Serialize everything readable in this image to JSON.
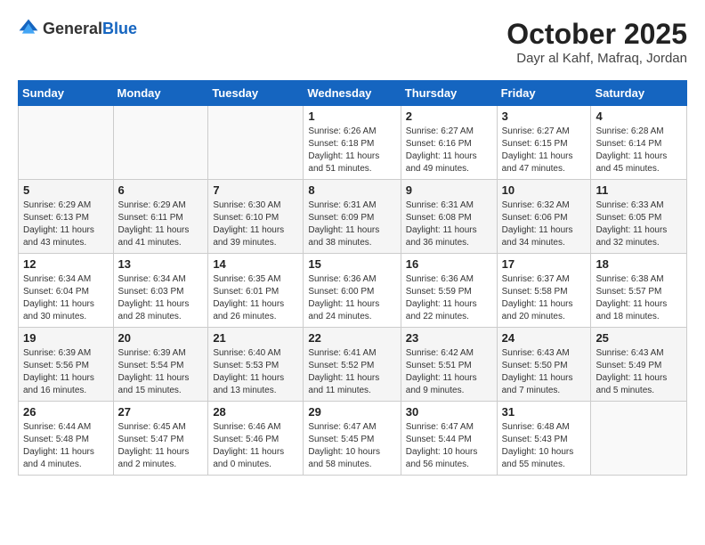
{
  "header": {
    "logo_general": "General",
    "logo_blue": "Blue",
    "month_title": "October 2025",
    "location": "Dayr al Kahf, Mafraq, Jordan"
  },
  "calendar": {
    "days_of_week": [
      "Sunday",
      "Monday",
      "Tuesday",
      "Wednesday",
      "Thursday",
      "Friday",
      "Saturday"
    ],
    "weeks": [
      [
        {
          "day": "",
          "info": ""
        },
        {
          "day": "",
          "info": ""
        },
        {
          "day": "",
          "info": ""
        },
        {
          "day": "1",
          "info": "Sunrise: 6:26 AM\nSunset: 6:18 PM\nDaylight: 11 hours\nand 51 minutes."
        },
        {
          "day": "2",
          "info": "Sunrise: 6:27 AM\nSunset: 6:16 PM\nDaylight: 11 hours\nand 49 minutes."
        },
        {
          "day": "3",
          "info": "Sunrise: 6:27 AM\nSunset: 6:15 PM\nDaylight: 11 hours\nand 47 minutes."
        },
        {
          "day": "4",
          "info": "Sunrise: 6:28 AM\nSunset: 6:14 PM\nDaylight: 11 hours\nand 45 minutes."
        }
      ],
      [
        {
          "day": "5",
          "info": "Sunrise: 6:29 AM\nSunset: 6:13 PM\nDaylight: 11 hours\nand 43 minutes."
        },
        {
          "day": "6",
          "info": "Sunrise: 6:29 AM\nSunset: 6:11 PM\nDaylight: 11 hours\nand 41 minutes."
        },
        {
          "day": "7",
          "info": "Sunrise: 6:30 AM\nSunset: 6:10 PM\nDaylight: 11 hours\nand 39 minutes."
        },
        {
          "day": "8",
          "info": "Sunrise: 6:31 AM\nSunset: 6:09 PM\nDaylight: 11 hours\nand 38 minutes."
        },
        {
          "day": "9",
          "info": "Sunrise: 6:31 AM\nSunset: 6:08 PM\nDaylight: 11 hours\nand 36 minutes."
        },
        {
          "day": "10",
          "info": "Sunrise: 6:32 AM\nSunset: 6:06 PM\nDaylight: 11 hours\nand 34 minutes."
        },
        {
          "day": "11",
          "info": "Sunrise: 6:33 AM\nSunset: 6:05 PM\nDaylight: 11 hours\nand 32 minutes."
        }
      ],
      [
        {
          "day": "12",
          "info": "Sunrise: 6:34 AM\nSunset: 6:04 PM\nDaylight: 11 hours\nand 30 minutes."
        },
        {
          "day": "13",
          "info": "Sunrise: 6:34 AM\nSunset: 6:03 PM\nDaylight: 11 hours\nand 28 minutes."
        },
        {
          "day": "14",
          "info": "Sunrise: 6:35 AM\nSunset: 6:01 PM\nDaylight: 11 hours\nand 26 minutes."
        },
        {
          "day": "15",
          "info": "Sunrise: 6:36 AM\nSunset: 6:00 PM\nDaylight: 11 hours\nand 24 minutes."
        },
        {
          "day": "16",
          "info": "Sunrise: 6:36 AM\nSunset: 5:59 PM\nDaylight: 11 hours\nand 22 minutes."
        },
        {
          "day": "17",
          "info": "Sunrise: 6:37 AM\nSunset: 5:58 PM\nDaylight: 11 hours\nand 20 minutes."
        },
        {
          "day": "18",
          "info": "Sunrise: 6:38 AM\nSunset: 5:57 PM\nDaylight: 11 hours\nand 18 minutes."
        }
      ],
      [
        {
          "day": "19",
          "info": "Sunrise: 6:39 AM\nSunset: 5:56 PM\nDaylight: 11 hours\nand 16 minutes."
        },
        {
          "day": "20",
          "info": "Sunrise: 6:39 AM\nSunset: 5:54 PM\nDaylight: 11 hours\nand 15 minutes."
        },
        {
          "day": "21",
          "info": "Sunrise: 6:40 AM\nSunset: 5:53 PM\nDaylight: 11 hours\nand 13 minutes."
        },
        {
          "day": "22",
          "info": "Sunrise: 6:41 AM\nSunset: 5:52 PM\nDaylight: 11 hours\nand 11 minutes."
        },
        {
          "day": "23",
          "info": "Sunrise: 6:42 AM\nSunset: 5:51 PM\nDaylight: 11 hours\nand 9 minutes."
        },
        {
          "day": "24",
          "info": "Sunrise: 6:43 AM\nSunset: 5:50 PM\nDaylight: 11 hours\nand 7 minutes."
        },
        {
          "day": "25",
          "info": "Sunrise: 6:43 AM\nSunset: 5:49 PM\nDaylight: 11 hours\nand 5 minutes."
        }
      ],
      [
        {
          "day": "26",
          "info": "Sunrise: 6:44 AM\nSunset: 5:48 PM\nDaylight: 11 hours\nand 4 minutes."
        },
        {
          "day": "27",
          "info": "Sunrise: 6:45 AM\nSunset: 5:47 PM\nDaylight: 11 hours\nand 2 minutes."
        },
        {
          "day": "28",
          "info": "Sunrise: 6:46 AM\nSunset: 5:46 PM\nDaylight: 11 hours\nand 0 minutes."
        },
        {
          "day": "29",
          "info": "Sunrise: 6:47 AM\nSunset: 5:45 PM\nDaylight: 10 hours\nand 58 minutes."
        },
        {
          "day": "30",
          "info": "Sunrise: 6:47 AM\nSunset: 5:44 PM\nDaylight: 10 hours\nand 56 minutes."
        },
        {
          "day": "31",
          "info": "Sunrise: 6:48 AM\nSunset: 5:43 PM\nDaylight: 10 hours\nand 55 minutes."
        },
        {
          "day": "",
          "info": ""
        }
      ]
    ]
  }
}
